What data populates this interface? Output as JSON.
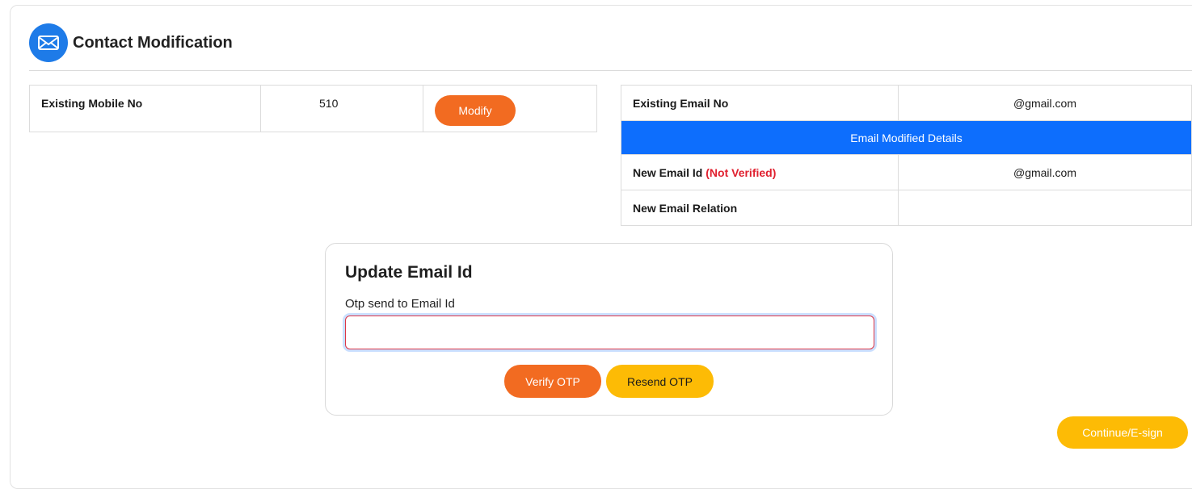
{
  "header": {
    "title": "Contact Modification",
    "icon": "envelope-icon"
  },
  "mobile": {
    "label": "Existing Mobile No",
    "value": "510",
    "modify_label": "Modify"
  },
  "email": {
    "existing_label": "Existing Email No",
    "existing_value": "@gmail.com",
    "banner": "Email Modified Details",
    "new_label": "New Email Id",
    "new_status": "(Not Verified)",
    "new_value": "@gmail.com",
    "relation_label": "New Email Relation",
    "relation_value": ""
  },
  "otp": {
    "title": "Update Email Id",
    "field_label": "Otp send to Email Id",
    "input_value": "",
    "verify_label": "Verify OTP",
    "resend_label": "Resend OTP"
  },
  "footer": {
    "continue_label": "Continue/E-sign"
  },
  "colors": {
    "primary_blue": "#0d6efd",
    "icon_blue": "#1e7be8",
    "orange": "#f26b21",
    "yellow": "#fdbb05",
    "error_red": "#e0202f"
  }
}
